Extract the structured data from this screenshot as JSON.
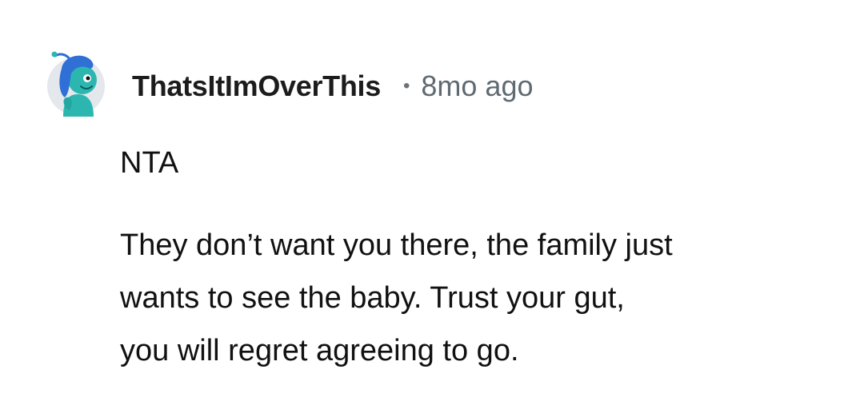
{
  "comment": {
    "username": "ThatsItImOverThis",
    "separator": "•",
    "timestamp": "8mo ago",
    "verdict": "NTA",
    "body_lines": [
      "They don’t want you there, the family just",
      "wants to see the baby. Trust your gut,",
      "you will regret agreeing to go."
    ]
  },
  "avatar": {
    "icon": "user-avatar-icon",
    "colors": {
      "character": "#2bb7b0",
      "hair": "#2f6fd6",
      "background": "#e4e8ec"
    }
  }
}
